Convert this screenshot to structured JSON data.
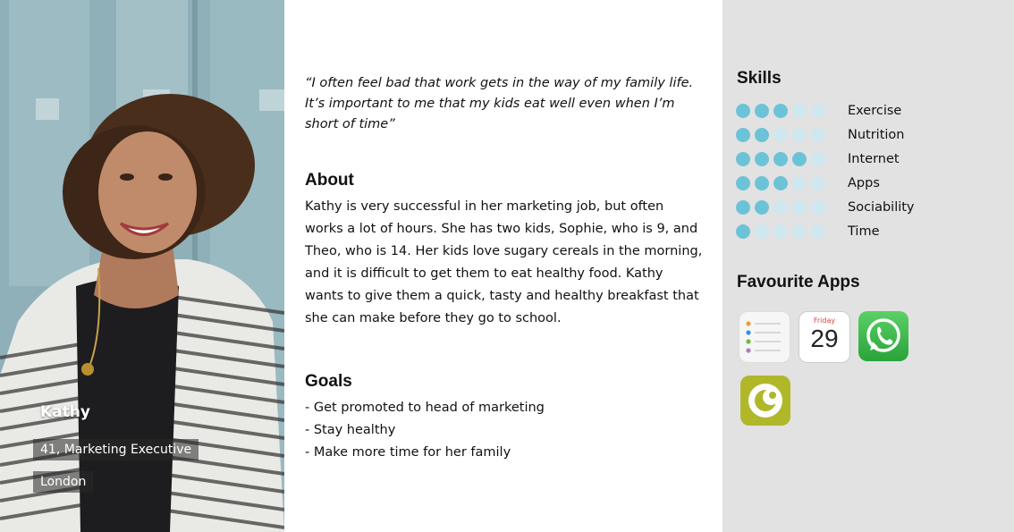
{
  "persona": {
    "name": "Kathy",
    "role": "41, Marketing Executive",
    "location": "London"
  },
  "quote": "“I often feel bad that work gets in the way of my family life. It’s important to me that my kids eat well even when I’m short of time”",
  "about": {
    "heading": "About",
    "text": "Kathy is very successful in her marketing job, but often works a lot of hours. She has two kids, Sophie, who is 9, and Theo, who is 14. Her kids love sugary cereals in the morning, and it is difficult to get them to eat healthy food. Kathy wants to give them a quick, tasty and healthy breakfast that she can make before they go to school."
  },
  "goals": {
    "heading": "Goals",
    "items": [
      "- Get promoted to head of marketing",
      "- Stay healthy",
      "- Make more time for her family"
    ]
  },
  "skills": {
    "heading": "Skills",
    "max": 5,
    "items": [
      {
        "label": "Exercise",
        "level": 3
      },
      {
        "label": "Nutrition",
        "level": 2
      },
      {
        "label": "Internet",
        "level": 4
      },
      {
        "label": "Apps",
        "level": 3
      },
      {
        "label": "Sociability",
        "level": 2
      },
      {
        "label": "Time",
        "level": 1
      }
    ]
  },
  "favourite_apps": {
    "heading": "Favourite Apps",
    "items": [
      {
        "icon": "reminders-app-icon"
      },
      {
        "icon": "calendar-app-icon",
        "day": "Friday",
        "date": "29"
      },
      {
        "icon": "whatsapp-app-icon"
      },
      {
        "icon": "ocado-app-icon"
      }
    ]
  },
  "colors": {
    "dot_on": "#6cc3d8",
    "dot_off": "#cfe7ee",
    "sidebar_bg": "#e2e2e2"
  }
}
